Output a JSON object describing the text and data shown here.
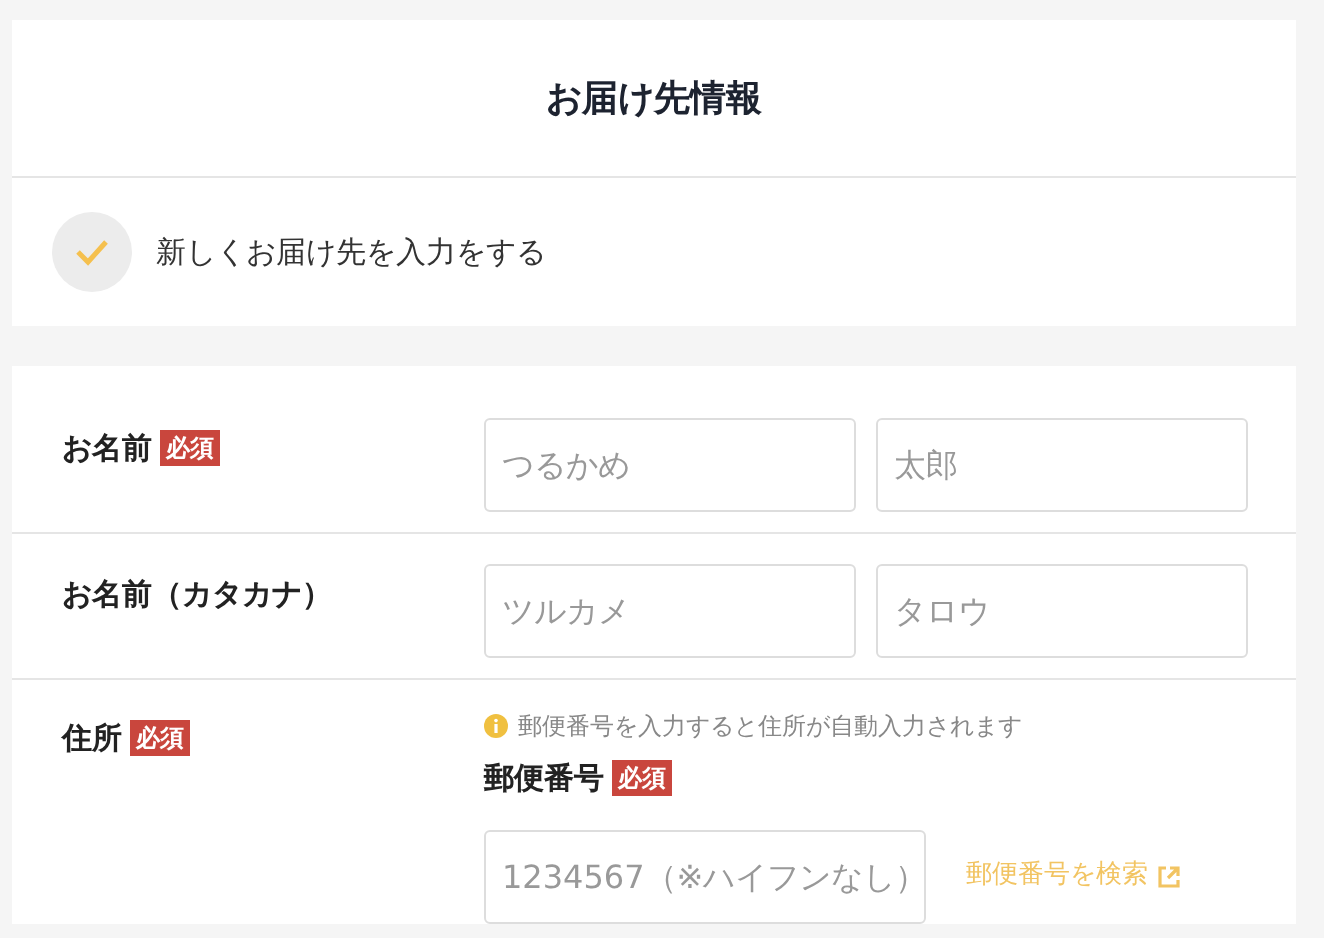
{
  "header": {
    "title": "お届け先情報"
  },
  "new_address": {
    "label": "新しくお届け先を入力をする",
    "checked": true
  },
  "rows": [
    {
      "kind": "pair",
      "label": "お名前",
      "required": true,
      "badge": "必須",
      "fields": [
        {
          "placeholder": "つるかめ"
        },
        {
          "placeholder": "太郎"
        }
      ]
    },
    {
      "kind": "pair",
      "label": "お名前（カタカナ）",
      "required": false,
      "fields": [
        {
          "placeholder": "ツルカメ"
        },
        {
          "placeholder": "タロウ"
        }
      ]
    },
    {
      "kind": "address",
      "label": "住所",
      "required": true,
      "badge": "必須",
      "hint": "郵便番号を入力すると住所が自動入力されます",
      "postal_label": "郵便番号",
      "postal_required": true,
      "postal_badge": "必須",
      "postal_placeholder": "1234567（※ハイフンなし）",
      "search_link": "郵便番号を検索"
    }
  ]
}
